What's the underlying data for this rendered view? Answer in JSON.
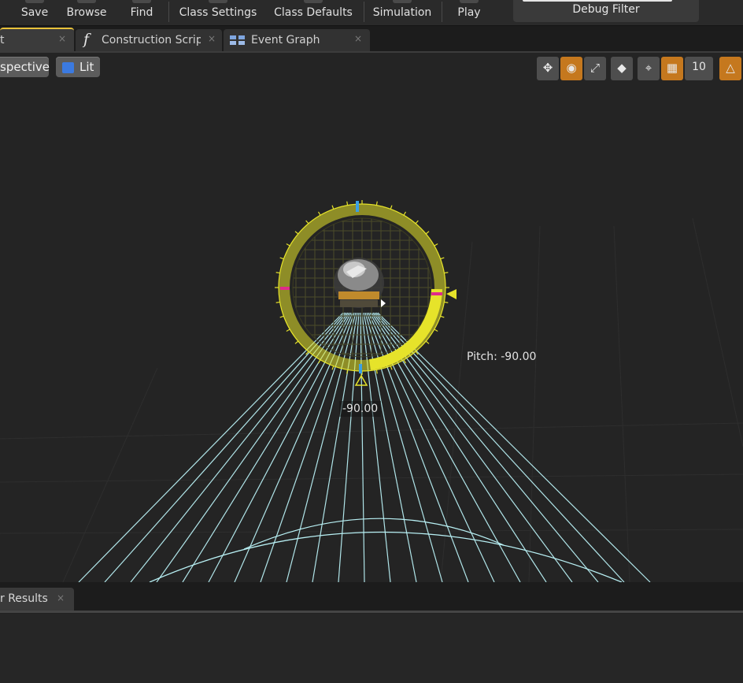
{
  "toolbar": {
    "buttons": [
      {
        "label": "Save",
        "icon": "save-icon"
      },
      {
        "label": "Browse",
        "icon": "browse-icon"
      },
      {
        "label": "Find",
        "icon": "find-icon"
      },
      {
        "label": "Class Settings",
        "icon": "class-settings-icon"
      },
      {
        "label": "Class Defaults",
        "icon": "class-defaults-icon"
      },
      {
        "label": "Simulation",
        "icon": "simulation-icon"
      },
      {
        "label": "Play",
        "icon": "play-icon"
      }
    ],
    "debug_filter_label": "Debug Filter"
  },
  "tabs": [
    {
      "label": "t",
      "icon": "viewport-icon",
      "active": true
    },
    {
      "label": "Construction Scrip",
      "icon": "function-icon",
      "active": false
    },
    {
      "label": "Event Graph",
      "icon": "event-graph-icon",
      "active": false
    }
  ],
  "viewport": {
    "view_mode": "spective",
    "lighting_mode": "Lit",
    "grid_snap_value": "10",
    "pitch_label": "Pitch: -90.00",
    "pitch_value": "-90.00",
    "tools": [
      {
        "icon": "translate-icon",
        "on": false
      },
      {
        "icon": "rotate-icon",
        "on": true
      },
      {
        "icon": "scale-icon",
        "on": false
      },
      {
        "icon": "world-local-icon",
        "on": false
      },
      {
        "icon": "surface-snap-icon",
        "on": false
      },
      {
        "icon": "grid-snap-icon",
        "on": true
      },
      {
        "icon": "rotation-snap-icon",
        "on": true
      }
    ],
    "colors": {
      "gizmo_ring": "#e6e32a",
      "light_cone": "#b8f0f4",
      "accent_orange": "#c5781e",
      "pitch_tick_blue": "#3aa0e6",
      "pitch_tick_magenta": "#e02a8a"
    }
  },
  "bottom": {
    "results_tab_label": "r Results"
  },
  "close_glyph": "×"
}
